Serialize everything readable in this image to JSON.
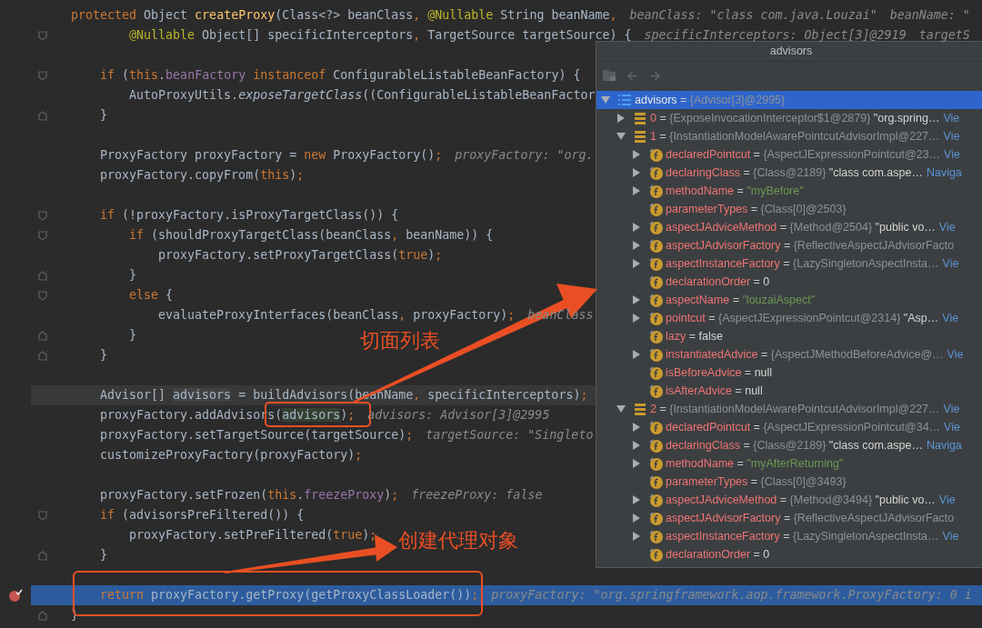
{
  "editor": {
    "lines": [
      {
        "kind": "plain",
        "tokens": [
          {
            "kind": "kw",
            "text": "protected"
          },
          {
            "kind": "plain",
            "text": " Object "
          },
          {
            "kind": "decl",
            "text": "createProxy"
          },
          {
            "kind": "plain",
            "text": "(Class<?> beanClass"
          },
          {
            "kind": "punct",
            "text": ", "
          },
          {
            "kind": "anno",
            "text": "@Nullable"
          },
          {
            "kind": "plain",
            "text": " String beanName"
          },
          {
            "kind": "punct",
            "text": ","
          }
        ],
        "hints": [
          "beanClass: \"class com.java.Louzai\"",
          "beanName: \""
        ],
        "current": false,
        "breakpoint": false
      },
      {
        "kind": "fold-start",
        "tokens": [
          {
            "kind": "anno",
            "text": "        @Nullable"
          },
          {
            "kind": "plain",
            "text": " Object[] specificInterceptors"
          },
          {
            "kind": "punct",
            "text": ", "
          },
          {
            "kind": "plain",
            "text": "TargetSource targetSource) {"
          }
        ],
        "hints": [
          "specificInterceptors: Object[3]@2919",
          "targetS"
        ],
        "current": false,
        "breakpoint": false
      },
      {
        "kind": "plain",
        "current": false,
        "breakpoint": false
      },
      {
        "kind": "fold-start",
        "tokens": [
          {
            "kind": "kw",
            "text": "    if"
          },
          {
            "kind": "plain",
            "text": " ("
          },
          {
            "kind": "kw",
            "text": "this"
          },
          {
            "kind": "plain",
            "text": "."
          },
          {
            "kind": "field",
            "text": "beanFactory"
          },
          {
            "kind": "kw",
            "text": " instanceof"
          },
          {
            "kind": "plain",
            "text": " ConfigurableListableBeanFactory) {"
          }
        ],
        "current": false,
        "breakpoint": false
      },
      {
        "kind": "plain",
        "tokens": [
          {
            "kind": "plain",
            "text": "        AutoProxyUtils."
          },
          {
            "kind": "italic",
            "text": "exposeTargetClass"
          },
          {
            "kind": "plain",
            "text": "((ConfigurableListableBeanFactor"
          }
        ],
        "current": false,
        "breakpoint": false
      },
      {
        "kind": "fold-end",
        "tokens": [
          {
            "kind": "plain",
            "text": "    }"
          }
        ],
        "current": false,
        "breakpoint": false
      },
      {
        "kind": "plain",
        "current": false,
        "breakpoint": false
      },
      {
        "kind": "plain",
        "tokens": [
          {
            "kind": "plain",
            "text": "    ProxyFactory proxyFactory = "
          },
          {
            "kind": "kw",
            "text": "new"
          },
          {
            "kind": "plain",
            "text": " ProxyFactory()"
          },
          {
            "kind": "punct",
            "text": ";"
          }
        ],
        "hints": [
          "proxyFactory: \"org."
        ],
        "current": false,
        "breakpoint": false
      },
      {
        "kind": "plain",
        "tokens": [
          {
            "kind": "plain",
            "text": "    proxyFactory.copyFrom("
          },
          {
            "kind": "kw",
            "text": "this"
          },
          {
            "kind": "plain",
            "text": ")"
          },
          {
            "kind": "punct",
            "text": ";"
          }
        ],
        "current": false,
        "breakpoint": false
      },
      {
        "kind": "plain",
        "current": false,
        "breakpoint": false
      },
      {
        "kind": "fold-start",
        "tokens": [
          {
            "kind": "kw",
            "text": "    if"
          },
          {
            "kind": "plain",
            "text": " (!proxyFactory.isProxyTargetClass()) {"
          }
        ],
        "current": false,
        "breakpoint": false
      },
      {
        "kind": "fold-start",
        "tokens": [
          {
            "kind": "kw",
            "text": "        if"
          },
          {
            "kind": "plain",
            "text": " (shouldProxyTargetClass(beanClass"
          },
          {
            "kind": "punct",
            "text": ", "
          },
          {
            "kind": "plain",
            "text": "beanName)) {"
          }
        ],
        "current": false,
        "breakpoint": false
      },
      {
        "kind": "plain",
        "tokens": [
          {
            "kind": "plain",
            "text": "            proxyFactory.setProxyTargetClass("
          },
          {
            "kind": "kw",
            "text": "true"
          },
          {
            "kind": "plain",
            "text": ")"
          },
          {
            "kind": "punct",
            "text": ";"
          }
        ],
        "current": false,
        "breakpoint": false
      },
      {
        "kind": "fold-end",
        "tokens": [
          {
            "kind": "plain",
            "text": "        }"
          }
        ],
        "current": false,
        "breakpoint": false
      },
      {
        "kind": "fold-start",
        "tokens": [
          {
            "kind": "kw",
            "text": "        else"
          },
          {
            "kind": "plain",
            "text": " {"
          }
        ],
        "current": false,
        "breakpoint": false
      },
      {
        "kind": "plain",
        "tokens": [
          {
            "kind": "plain",
            "text": "            evaluateProxyInterfaces(beanClass"
          },
          {
            "kind": "punct",
            "text": ", "
          },
          {
            "kind": "plain",
            "text": "proxyFactory)"
          },
          {
            "kind": "punct",
            "text": ";"
          }
        ],
        "hints": [
          "beanClass"
        ],
        "current": false,
        "breakpoint": false
      },
      {
        "kind": "fold-end",
        "tokens": [
          {
            "kind": "plain",
            "text": "        }"
          }
        ],
        "current": false,
        "breakpoint": false
      },
      {
        "kind": "fold-end",
        "tokens": [
          {
            "kind": "plain",
            "text": "    }"
          }
        ],
        "current": false,
        "breakpoint": false
      },
      {
        "kind": "plain",
        "current": false,
        "breakpoint": false
      },
      {
        "kind": "plain",
        "tokens": [
          {
            "kind": "plain",
            "text": "    Advisor[] "
          },
          {
            "kind": "var-decl",
            "text": "advisors"
          },
          {
            "kind": "plain",
            "text": " = buildAdvisors(beanName"
          },
          {
            "kind": "punct",
            "text": ", "
          },
          {
            "kind": "plain",
            "text": "specificInterceptors)"
          },
          {
            "kind": "punct",
            "text": ";"
          }
        ],
        "current": false,
        "breakpoint": false,
        "caret": true
      },
      {
        "kind": "plain",
        "tokens": [
          {
            "kind": "plain",
            "text": "    proxyFactory.addAdvisors("
          },
          {
            "kind": "var-use",
            "text": "advisors"
          },
          {
            "kind": "plain",
            "text": ")"
          },
          {
            "kind": "punct",
            "text": ";"
          }
        ],
        "hints": [
          "advisors: Advisor[3]@2995"
        ],
        "current": false,
        "breakpoint": false
      },
      {
        "kind": "plain",
        "tokens": [
          {
            "kind": "plain",
            "text": "    proxyFactory.setTargetSource(targetSource)"
          },
          {
            "kind": "punct",
            "text": ";"
          }
        ],
        "hints": [
          "targetSource: \"Singleto"
        ],
        "current": false,
        "breakpoint": false
      },
      {
        "kind": "plain",
        "tokens": [
          {
            "kind": "plain",
            "text": "    customizeProxyFactory(proxyFactory)"
          },
          {
            "kind": "punct",
            "text": ";"
          }
        ],
        "current": false,
        "breakpoint": false
      },
      {
        "kind": "plain",
        "current": false,
        "breakpoint": false
      },
      {
        "kind": "plain",
        "tokens": [
          {
            "kind": "plain",
            "text": "    proxyFactory.setFrozen("
          },
          {
            "kind": "kw",
            "text": "this"
          },
          {
            "kind": "plain",
            "text": "."
          },
          {
            "kind": "field",
            "text": "freezeProxy"
          },
          {
            "kind": "plain",
            "text": ")"
          },
          {
            "kind": "punct",
            "text": ";"
          }
        ],
        "hints": [
          "freezeProxy: false"
        ],
        "current": false,
        "breakpoint": false
      },
      {
        "kind": "fold-start",
        "tokens": [
          {
            "kind": "kw",
            "text": "    if"
          },
          {
            "kind": "plain",
            "text": " (advisorsPreFiltered()) {"
          }
        ],
        "current": false,
        "breakpoint": false
      },
      {
        "kind": "plain",
        "tokens": [
          {
            "kind": "plain",
            "text": "        proxyFactory.setPreFiltered("
          },
          {
            "kind": "kw",
            "text": "true"
          },
          {
            "kind": "plain",
            "text": ")"
          },
          {
            "kind": "punct",
            "text": ";"
          }
        ],
        "current": false,
        "breakpoint": false
      },
      {
        "kind": "fold-end",
        "tokens": [
          {
            "kind": "plain",
            "text": "    }"
          }
        ],
        "current": false,
        "breakpoint": false
      },
      {
        "kind": "plain",
        "current": false,
        "breakpoint": false
      },
      {
        "kind": "plain",
        "tokens": [
          {
            "kind": "kw",
            "text": "    return"
          },
          {
            "kind": "plain",
            "text": " proxyFactory.getProxy(getProxyClassLoader())"
          },
          {
            "kind": "punct",
            "text": ";"
          }
        ],
        "hints": [
          "proxyFactory: \"org.springframework.aop.framework.ProxyFactory: 0 i"
        ],
        "current": true,
        "breakpoint": true
      },
      {
        "kind": "fold-end",
        "tokens": [
          {
            "kind": "plain",
            "text": "}"
          }
        ],
        "current": false,
        "breakpoint": false
      }
    ]
  },
  "popup": {
    "title": "advisors",
    "tree": [
      {
        "kind": "array",
        "name": "advisors",
        "op": "=",
        "ref": "{Advisor[3]@2995}",
        "expandable": true,
        "expanded": true,
        "selected": true,
        "children": [
          {
            "kind": "element",
            "name": "0",
            "op": "=",
            "ref": "{ExposeInvocationInterceptor$1@2879}",
            "value": "\"org.spring…",
            "link": "Vie",
            "expandable": true,
            "expanded": false,
            "selected": false
          },
          {
            "kind": "element",
            "name": "1",
            "op": "=",
            "ref": "{InstantiationModelAwarePointcutAdvisorImpl@227…",
            "link": "Vie",
            "expandable": true,
            "expanded": true,
            "selected": false,
            "children": [
              {
                "kind": "field",
                "name": "declaredPointcut",
                "op": "=",
                "ref": "{AspectJExpressionPointcut@23…",
                "link": "Vie",
                "expandable": true,
                "expanded": false,
                "selected": false
              },
              {
                "kind": "field",
                "name": "declaringClass",
                "op": "=",
                "ref": "{Class@2189}",
                "value": "\"class com.aspe…",
                "link": "Naviga",
                "expandable": true,
                "expanded": false,
                "selected": false
              },
              {
                "kind": "field",
                "name": "methodName",
                "op": "=",
                "string_value": "\"myBefore\"",
                "expandable": true,
                "expanded": false,
                "selected": false
              },
              {
                "kind": "field",
                "name": "parameterTypes",
                "op": "=",
                "ref": "{Class[0]@2503}",
                "expandable": false,
                "selected": false
              },
              {
                "kind": "field",
                "name": "aspectJAdviceMethod",
                "op": "=",
                "ref": "{Method@2504}",
                "value": "\"public vo…",
                "link": "Vie",
                "expandable": true,
                "expanded": false,
                "selected": false
              },
              {
                "kind": "field",
                "name": "aspectJAdvisorFactory",
                "op": "=",
                "ref": "{ReflectiveAspectJAdvisorFacto",
                "expandable": true,
                "expanded": false,
                "selected": false
              },
              {
                "kind": "field",
                "name": "aspectInstanceFactory",
                "op": "=",
                "ref": "{LazySingletonAspectInsta…",
                "link": "Vie",
                "expandable": true,
                "expanded": false,
                "selected": false
              },
              {
                "kind": "field",
                "name": "declarationOrder",
                "op": "=",
                "value": "0",
                "expandable": false,
                "selected": false
              },
              {
                "kind": "field",
                "name": "aspectName",
                "op": "=",
                "string_value": "\"louzaiAspect\"",
                "expandable": true,
                "expanded": false,
                "selected": false
              },
              {
                "kind": "field",
                "name": "pointcut",
                "op": "=",
                "ref": "{AspectJExpressionPointcut@2314}",
                "value": "\"Asp…",
                "link": "Vie",
                "expandable": true,
                "expanded": false,
                "selected": false
              },
              {
                "kind": "field",
                "name": "lazy",
                "op": "=",
                "value": "false",
                "expandable": false,
                "selected": false
              },
              {
                "kind": "field",
                "name": "instantiatedAdvice",
                "op": "=",
                "ref": "{AspectJMethodBeforeAdvice@…",
                "link": "Vie",
                "expandable": true,
                "expanded": false,
                "selected": false
              },
              {
                "kind": "field",
                "name": "isBeforeAdvice",
                "op": "=",
                "value": "null",
                "expandable": false,
                "selected": false
              },
              {
                "kind": "field",
                "name": "isAfterAdvice",
                "op": "=",
                "value": "null",
                "expandable": false,
                "selected": false
              }
            ]
          },
          {
            "kind": "element",
            "name": "2",
            "op": "=",
            "ref": "{InstantiationModelAwarePointcutAdvisorImpl@227…",
            "link": "Vie",
            "expandable": true,
            "expanded": true,
            "selected": false,
            "children": [
              {
                "kind": "field",
                "name": "declaredPointcut",
                "op": "=",
                "ref": "{AspectJExpressionPointcut@34…",
                "link": "Vie",
                "expandable": true,
                "expanded": false,
                "selected": false
              },
              {
                "kind": "field",
                "name": "declaringClass",
                "op": "=",
                "ref": "{Class@2189}",
                "value": "\"class com.aspe…",
                "link": "Naviga",
                "expandable": true,
                "expanded": false,
                "selected": false
              },
              {
                "kind": "field",
                "name": "methodName",
                "op": "=",
                "string_value": "\"myAfterReturning\"",
                "expandable": true,
                "expanded": false,
                "selected": false
              },
              {
                "kind": "field",
                "name": "parameterTypes",
                "op": "=",
                "ref": "{Class[0]@3493}",
                "expandable": false,
                "selected": false
              },
              {
                "kind": "field",
                "name": "aspectJAdviceMethod",
                "op": "=",
                "ref": "{Method@3494}",
                "value": "\"public vo…",
                "link": "Vie",
                "expandable": true,
                "expanded": false,
                "selected": false
              },
              {
                "kind": "field",
                "name": "aspectJAdvisorFactory",
                "op": "=",
                "ref": "{ReflectiveAspectJAdvisorFacto",
                "expandable": true,
                "expanded": false,
                "selected": false
              },
              {
                "kind": "field",
                "name": "aspectInstanceFactory",
                "op": "=",
                "ref": "{LazySingletonAspectInsta…",
                "link": "Vie",
                "expandable": true,
                "expanded": false,
                "selected": false
              },
              {
                "kind": "field",
                "name": "declarationOrder",
                "op": "=",
                "value": "0",
                "expandable": false,
                "selected": false
              }
            ]
          }
        ]
      }
    ]
  },
  "callouts": [
    {
      "text": "切面列表"
    },
    {
      "text": "创建代理对象"
    }
  ]
}
